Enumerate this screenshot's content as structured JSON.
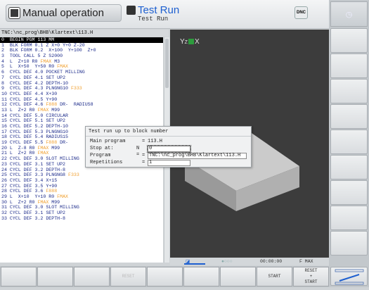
{
  "header": {
    "mode_manual": "Manual operation",
    "mode_test": "Test Run",
    "test_sub": "Test Run",
    "dnc": "DNC"
  },
  "path": "TNC:\\nc_prog\\BHB\\Klartext\\113.H",
  "program": [
    {
      "n": "0",
      "t": "  BEGIN PGM 113 MM",
      "sel": true
    },
    {
      "n": "1",
      "t": "  BLK FORM 0.1 Z X+0 Y+0 Z-20"
    },
    {
      "n": "2",
      "t": "  BLK FORM 0.2  X+100  Y+100  Z+0"
    },
    {
      "n": "3",
      "t": "  TOOL CALL 5 Z S2000"
    },
    {
      "n": "4",
      "t": "  L  Z+10 R0 ",
      "f": "FMAX",
      " tail": " M3"
    },
    {
      "n": "5",
      "t": "  L  X+50  Y+50 R0 ",
      "f": "FMAX"
    },
    {
      "n": "6",
      "t": "  CYCL DEF 4.0 POCKET MILLING"
    },
    {
      "n": "7",
      "t": "  CYCL DEF 4.1 SET UP2"
    },
    {
      "n": "8",
      "t": "  CYCL DEF 4.2 DEPTH-10"
    },
    {
      "n": "9",
      "t": "  CYCL DEF 4.3 PLNGNG10 ",
      "f": "F333"
    },
    {
      "n": "10",
      "t": " CYCL DEF 4.4 X+30"
    },
    {
      "n": "11",
      "t": " CYCL DEF 4.5 Y+90"
    },
    {
      "n": "12",
      "t": " CYCL DEF 4.6 ",
      "f": "F888",
      "tail": " DR-  RADIUS8"
    },
    {
      "n": "13",
      "t": " L  Z+2 R0 ",
      "f": "FMAX",
      "tail": " M99"
    },
    {
      "n": "14",
      "t": " CYCL DEF 5.0 CIRCULAR"
    },
    {
      "n": "15",
      "t": " CYCL DEF 5.1 SET UP2"
    },
    {
      "n": "16",
      "t": " CYCL DEF 5.2 DEPTH-10"
    },
    {
      "n": "17",
      "t": " CYCL DEF 5.3 PLNGNG10"
    },
    {
      "n": "18",
      "t": " CYCL DEF 5.4 RADIUS15"
    },
    {
      "n": "19",
      "t": " CYCL DEF 5.5 ",
      "f": "F888",
      "tail": " DR-"
    },
    {
      "n": "20",
      "t": " L  Z-8 R0 ",
      "f": "FMAX",
      "tail": " M99"
    },
    {
      "n": "21",
      "t": " L  Z+2 R0 ",
      "f": "FMAX"
    },
    {
      "n": "22",
      "t": " CYCL DEF 3.0 SLOT MILLING"
    },
    {
      "n": "23",
      "t": " CYCL DEF 3.1 SET UP2"
    },
    {
      "n": "24",
      "t": " CYCL DEF 3.2 DEPTH-8"
    },
    {
      "n": "25",
      "t": " CYCL DEF 3.3 PLNGNG8 ",
      "f": "F333"
    },
    {
      "n": "26",
      "t": " CYCL DEF 3.4 X+15"
    },
    {
      "n": "27",
      "t": " CYCL DEF 3.5 Y+90"
    },
    {
      "n": "28",
      "t": " CYCL DEF 3.6 ",
      "f": "F888"
    },
    {
      "n": "29",
      "t": " L  X+10  Y+10 R0 ",
      "f": "FMAX"
    },
    {
      "n": "30",
      "t": " L  Z+2 R0 ",
      "f": "FMAX",
      "tail": " M99"
    },
    {
      "n": "31",
      "t": " CYCL DEF 3.0 SLOT MILLING"
    },
    {
      "n": "32",
      "t": " CYCL DEF 3.1 SET UP2"
    },
    {
      "n": "33",
      "t": " CYCL DEF 3.2 DEPTH-8"
    }
  ],
  "dialog": {
    "title": "Test run up to block number",
    "main_label": "Main program",
    "main_value": "113.H",
    "stop_label": "Stop at:",
    "stop_sym": "N =",
    "stop_value": "0",
    "program_label": "Program",
    "program_value": "TNC:\\nc_prog\\BHB\\Klartext\\113.H",
    "rep_label": "Repetitions",
    "rep_value": "1",
    "eq": "="
  },
  "view": {
    "axis_y": "Y",
    "axis_z": "Z",
    "axis_x": "X"
  },
  "status": {
    "time": "00:00:00",
    "feed": "F MAX"
  },
  "softkeys": [
    "",
    "",
    "",
    "RESET",
    "",
    "",
    "",
    "START",
    "RESET\n+\nSTART"
  ]
}
